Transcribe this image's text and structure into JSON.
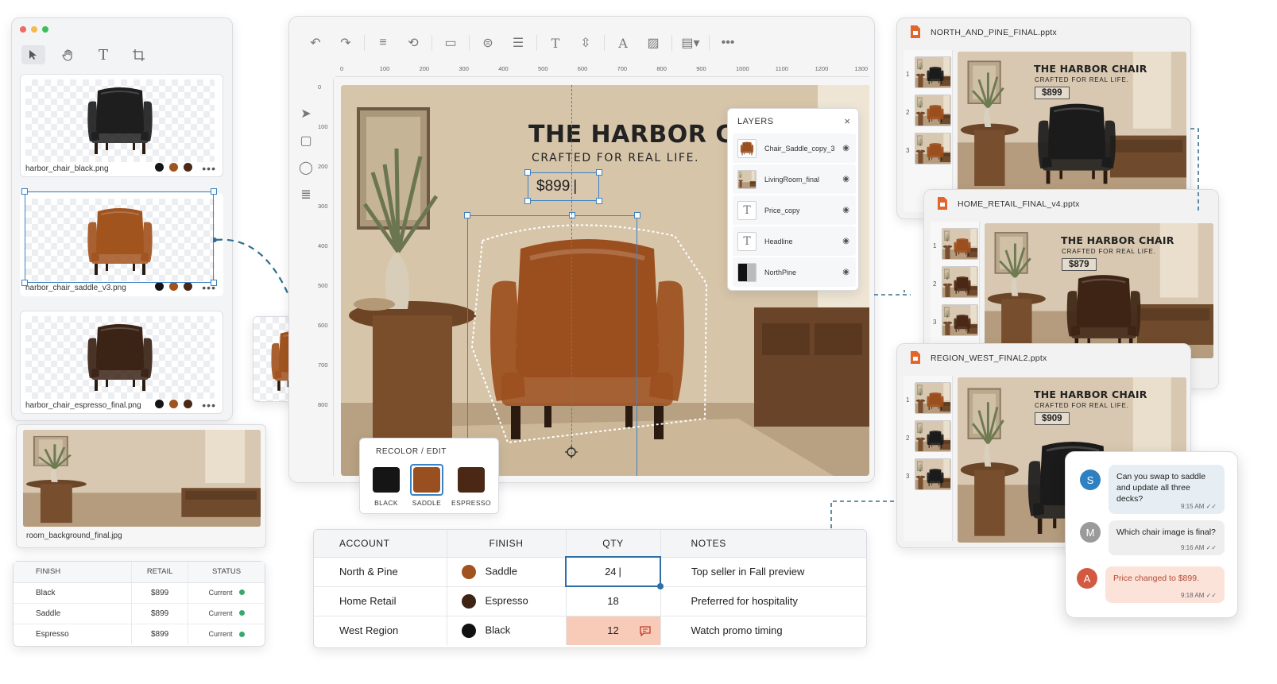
{
  "asset_panel": {
    "assets": [
      {
        "name": "harbor_chair_black.png"
      },
      {
        "name": "harbor_chair_saddle_v3.png"
      },
      {
        "name": "harbor_chair_espresso_final.png"
      }
    ],
    "more": "•••",
    "background_asset": {
      "name": "room_background_final.jpg"
    }
  },
  "finish_table": {
    "headers": [
      "FINISH",
      "RETAIL",
      "STATUS"
    ],
    "rows": [
      {
        "finish": "Black",
        "retail": "$899",
        "status": "Current"
      },
      {
        "finish": "Saddle",
        "retail": "$899",
        "status": "Current"
      },
      {
        "finish": "Espresso",
        "retail": "$899",
        "status": "Current"
      }
    ]
  },
  "editor": {
    "ruler_h": [
      "0",
      "100",
      "200",
      "300",
      "400",
      "500",
      "600",
      "700",
      "800",
      "900",
      "1000",
      "1100",
      "1200",
      "1300"
    ],
    "ruler_v": [
      "0",
      "100",
      "200",
      "300",
      "400",
      "500",
      "600",
      "700",
      "800"
    ],
    "canvas": {
      "headline": "THE HARBOR CHAIR",
      "subhead": "CRAFTED FOR REAL LIFE.",
      "price": "$899"
    }
  },
  "layers": {
    "title": "LAYERS",
    "close": "×",
    "items": [
      {
        "name": "Chair_Saddle_copy_3"
      },
      {
        "name": "LivingRoom_final"
      },
      {
        "name": "Price_copy"
      },
      {
        "name": "Headline"
      },
      {
        "name": "NorthPine"
      }
    ]
  },
  "recolor": {
    "title": "RECOLOR / EDIT",
    "options": [
      {
        "label": "BLACK",
        "color": "#151515"
      },
      {
        "label": "SADDLE",
        "color": "#9a4f21"
      },
      {
        "label": "ESPRESSO",
        "color": "#4a2815"
      }
    ],
    "selected": "SADDLE"
  },
  "data_table": {
    "headers": [
      "ACCOUNT",
      "FINISH",
      "QTY",
      "NOTES"
    ],
    "rows": [
      {
        "account": "North & Pine",
        "finish": "Saddle",
        "finish_color": "#a0521f",
        "qty": "24",
        "notes": "Top seller in Fall preview"
      },
      {
        "account": "Home Retail",
        "finish": "Espresso",
        "finish_color": "#3d2414",
        "qty": "18",
        "notes": "Preferred for hospitality"
      },
      {
        "account": "West Region",
        "finish": "Black",
        "finish_color": "#111111",
        "qty": "12",
        "notes": "Watch promo timing"
      }
    ]
  },
  "decks": [
    {
      "file": "NORTH_AND_PINE_FINAL.pptx",
      "title": "THE HARBOR CHAIR",
      "sub": "CRAFTED FOR REAL LIFE.",
      "price": "$899",
      "slides": [
        "1",
        "2",
        "3"
      ]
    },
    {
      "file": "HOME_RETAIL_FINAL_v4.pptx",
      "title": "THE HARBOR CHAIR",
      "sub": "CRAFTED FOR REAL LIFE.",
      "price": "$879",
      "slides": [
        "1",
        "2",
        "3"
      ]
    },
    {
      "file": "REGION_WEST_FINAL2.pptx",
      "title": "THE HARBOR CHAIR",
      "sub": "CRAFTED FOR REAL LIFE.",
      "price": "$909",
      "slides": [
        "1",
        "2",
        "3"
      ]
    }
  ],
  "chat": {
    "messages": [
      {
        "initial": "S",
        "color": "#2f80c0",
        "text": "Can you swap to saddle and update all three decks?",
        "time": "9:15 AM"
      },
      {
        "initial": "M",
        "color": "#9a9a9a",
        "text": "Which chair image is final?",
        "time": "9:16 AM"
      },
      {
        "initial": "A",
        "color": "#d35a42",
        "text": "Price changed to $899.",
        "time": "9:18 AM"
      }
    ]
  },
  "colors": {
    "accent": "#3b82c4",
    "black": "#151515",
    "saddle": "#9a4f21",
    "espresso": "#4a2815",
    "alert_cell": "#f8cbb8"
  }
}
